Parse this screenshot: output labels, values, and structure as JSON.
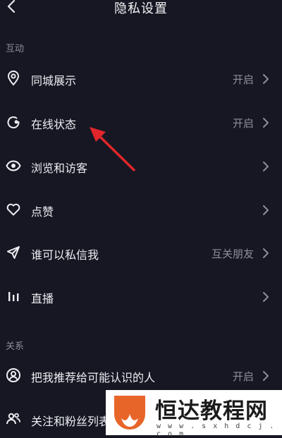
{
  "header": {
    "title": "隐私设置",
    "back_icon": "chevron-left-icon"
  },
  "sections": [
    {
      "label": "互动"
    },
    {
      "label": "关系"
    }
  ],
  "rows": [
    {
      "label": "同城展示",
      "value": "开启",
      "icon": "location-pin-icon",
      "chevron": true
    },
    {
      "label": "在线状态",
      "value": "开启",
      "icon": "online-status-icon",
      "chevron": true
    },
    {
      "label": "浏览和访客",
      "value": "",
      "icon": "eye-icon",
      "chevron": true
    },
    {
      "label": "点赞",
      "value": "",
      "icon": "heart-icon",
      "chevron": true
    },
    {
      "label": "谁可以私信我",
      "value": "互关朋友",
      "icon": "send-icon",
      "chevron": true
    },
    {
      "label": "直播",
      "value": "",
      "icon": "live-bars-icon",
      "chevron": true
    },
    {
      "label": "把我推荐给可能认识的人",
      "value": "开启",
      "icon": "user-circle-icon",
      "chevron": true
    },
    {
      "label": "关注和粉丝列表",
      "value": "",
      "icon": "users-icon",
      "chevron": false
    }
  ],
  "annotation": {
    "color": "#e0262b"
  },
  "watermark": {
    "name": "恒达教程网",
    "url": "w w w . s x h d c j . c o m",
    "color": "#e8652a"
  },
  "colors": {
    "background": "#161722",
    "text": "#eceef3",
    "muted": "#8e8f99"
  }
}
